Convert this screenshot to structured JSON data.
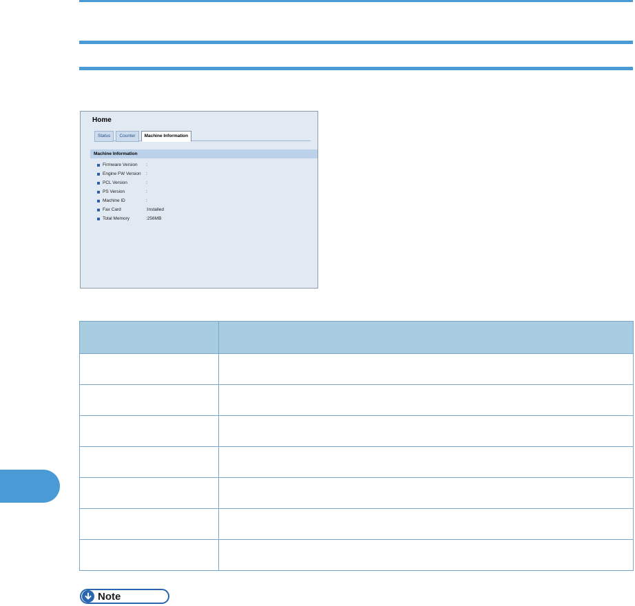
{
  "panel": {
    "title": "Home",
    "tabs": [
      {
        "label": "Status"
      },
      {
        "label": "Counter"
      },
      {
        "label": "Machine Information"
      }
    ],
    "section_title": "Machine Information",
    "rows": [
      {
        "label": "Firmware Version",
        "value": ":"
      },
      {
        "label": "Engine FW Version",
        "value": ":"
      },
      {
        "label": "PCL Version",
        "value": ":"
      },
      {
        "label": "PS Version",
        "value": ":"
      },
      {
        "label": "Machine ID",
        "value": ":"
      },
      {
        "label": "Fax Card",
        "value": ":Installed"
      },
      {
        "label": "Total Memory",
        "value": ":256MB"
      }
    ]
  },
  "note": {
    "label": "Note",
    "icon": "down-arrow-circle-icon"
  },
  "colors": {
    "accent": "#4a9ad6",
    "table_header": "#a8cde1",
    "panel_bg": "#e1e9f3"
  }
}
